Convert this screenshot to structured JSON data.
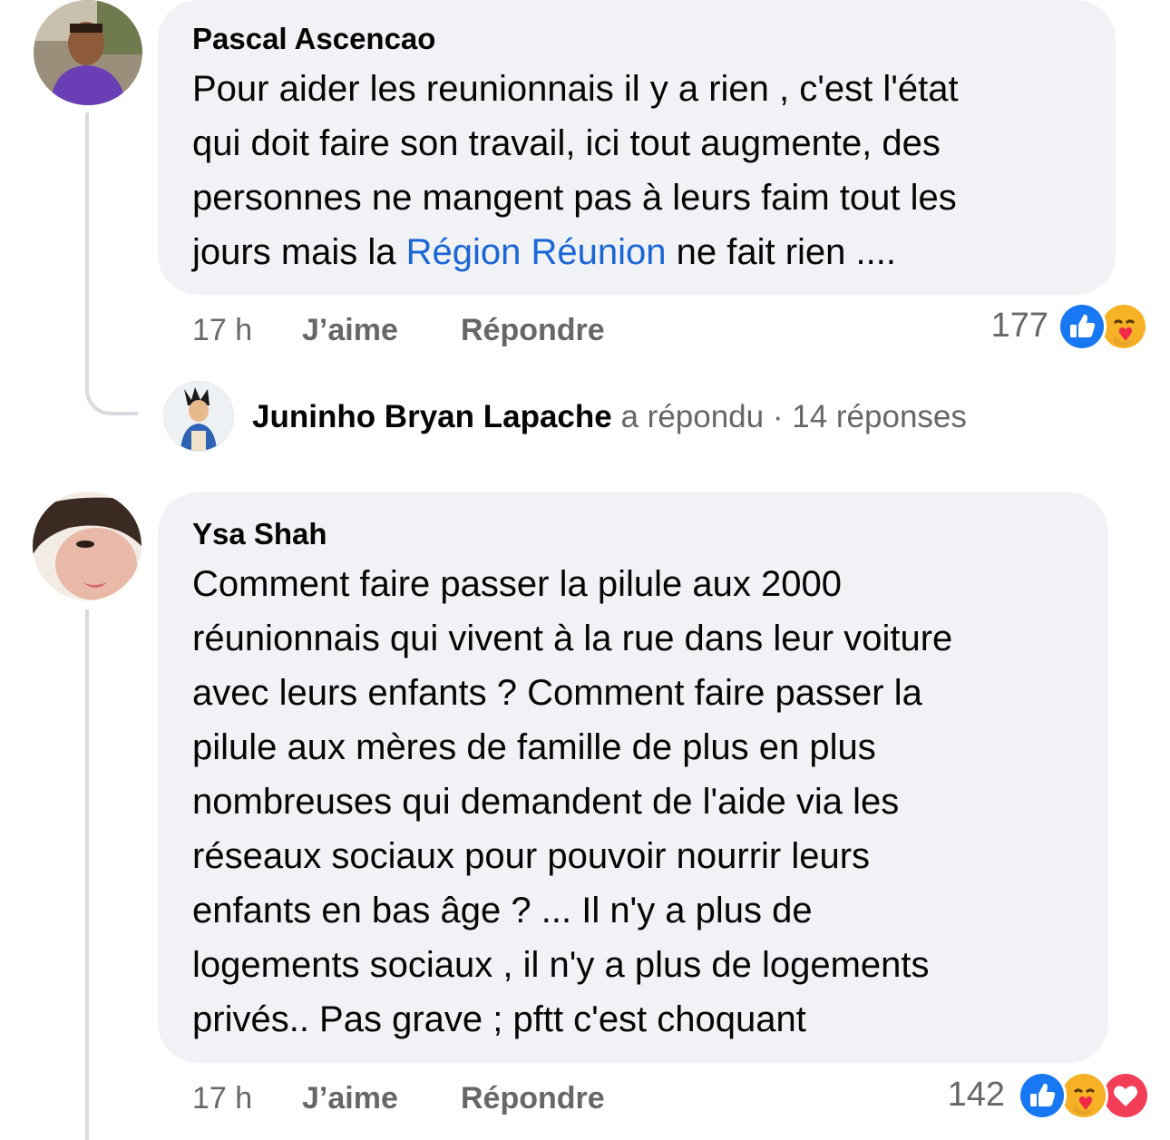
{
  "comments": [
    {
      "author": "Pascal Ascencao",
      "lines": [
        "Pour aider les reunionnais il y a rien , c'est l'état",
        "qui doit faire son travail,  ici tout augmente,  des",
        "personnes ne mangent pas à leurs faim tout les"
      ],
      "last_line_before": "jours mais la ",
      "last_line_link": "Région Réunion",
      "last_line_after": " ne fait rien ....",
      "time": "17 h",
      "like_label": "J’aime",
      "reply_label": "Répondre",
      "reaction_count": "177",
      "reactions": [
        "like-icon",
        "care-icon"
      ],
      "avatar": "pascal-avatar"
    },
    {
      "author": "Ysa Shah",
      "lines": [
        "Comment faire passer la pilule aux 2000",
        "réunionnais  qui vivent à la rue dans leur voiture",
        "avec leurs enfants ?  Comment faire passer la",
        "pilule aux mères de famille de plus en plus",
        "nombreuses qui demandent de l'aide via les",
        "réseaux sociaux pour pouvoir  nourrir leurs",
        "enfants en bas âge  ? ... Il n'y a plus de",
        "logements sociaux , il n'y a plus de logements",
        "privés..  Pas grave ; pftt c'est choquant"
      ],
      "time": "17 h",
      "like_label": "J’aime",
      "reply_label": "Répondre",
      "reaction_count": "142",
      "reactions": [
        "like-icon",
        "care-icon",
        "love-icon"
      ],
      "avatar": "ysa-avatar"
    }
  ],
  "reply_summary": {
    "name": "Juninho Bryan Lapache",
    "action": " a répondu",
    "separator": " · ",
    "count": "14 réponses"
  },
  "colors": {
    "bubble": "#f0f2f5",
    "meta": "#65676b",
    "link": "#1b66d6",
    "like": "#1877f2",
    "love": "#f33e58",
    "care": "#f7b125"
  }
}
